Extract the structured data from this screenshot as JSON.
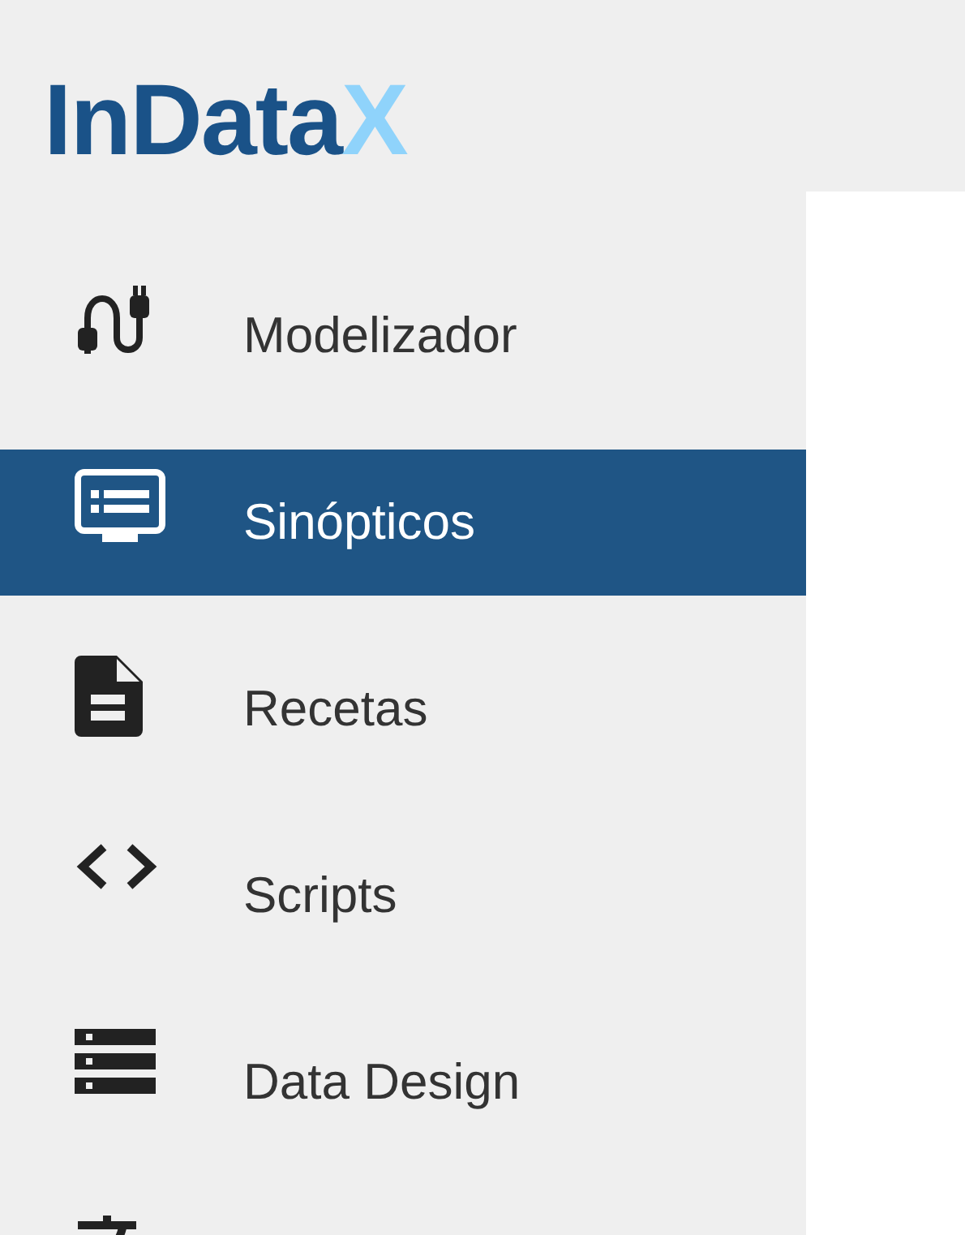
{
  "logo": {
    "text": "InData",
    "accent": "X"
  },
  "sidebar": {
    "items": [
      {
        "kind": "cable",
        "label": "Modelizador",
        "selected": false
      },
      {
        "kind": "monitor",
        "label": "Sinópticos",
        "selected": true
      },
      {
        "kind": "file",
        "label": "Recetas",
        "selected": false
      },
      {
        "kind": "code",
        "label": "Scripts",
        "selected": false
      },
      {
        "kind": "server",
        "label": "Data Design",
        "selected": false
      },
      {
        "kind": "translate",
        "selected": false
      }
    ]
  }
}
